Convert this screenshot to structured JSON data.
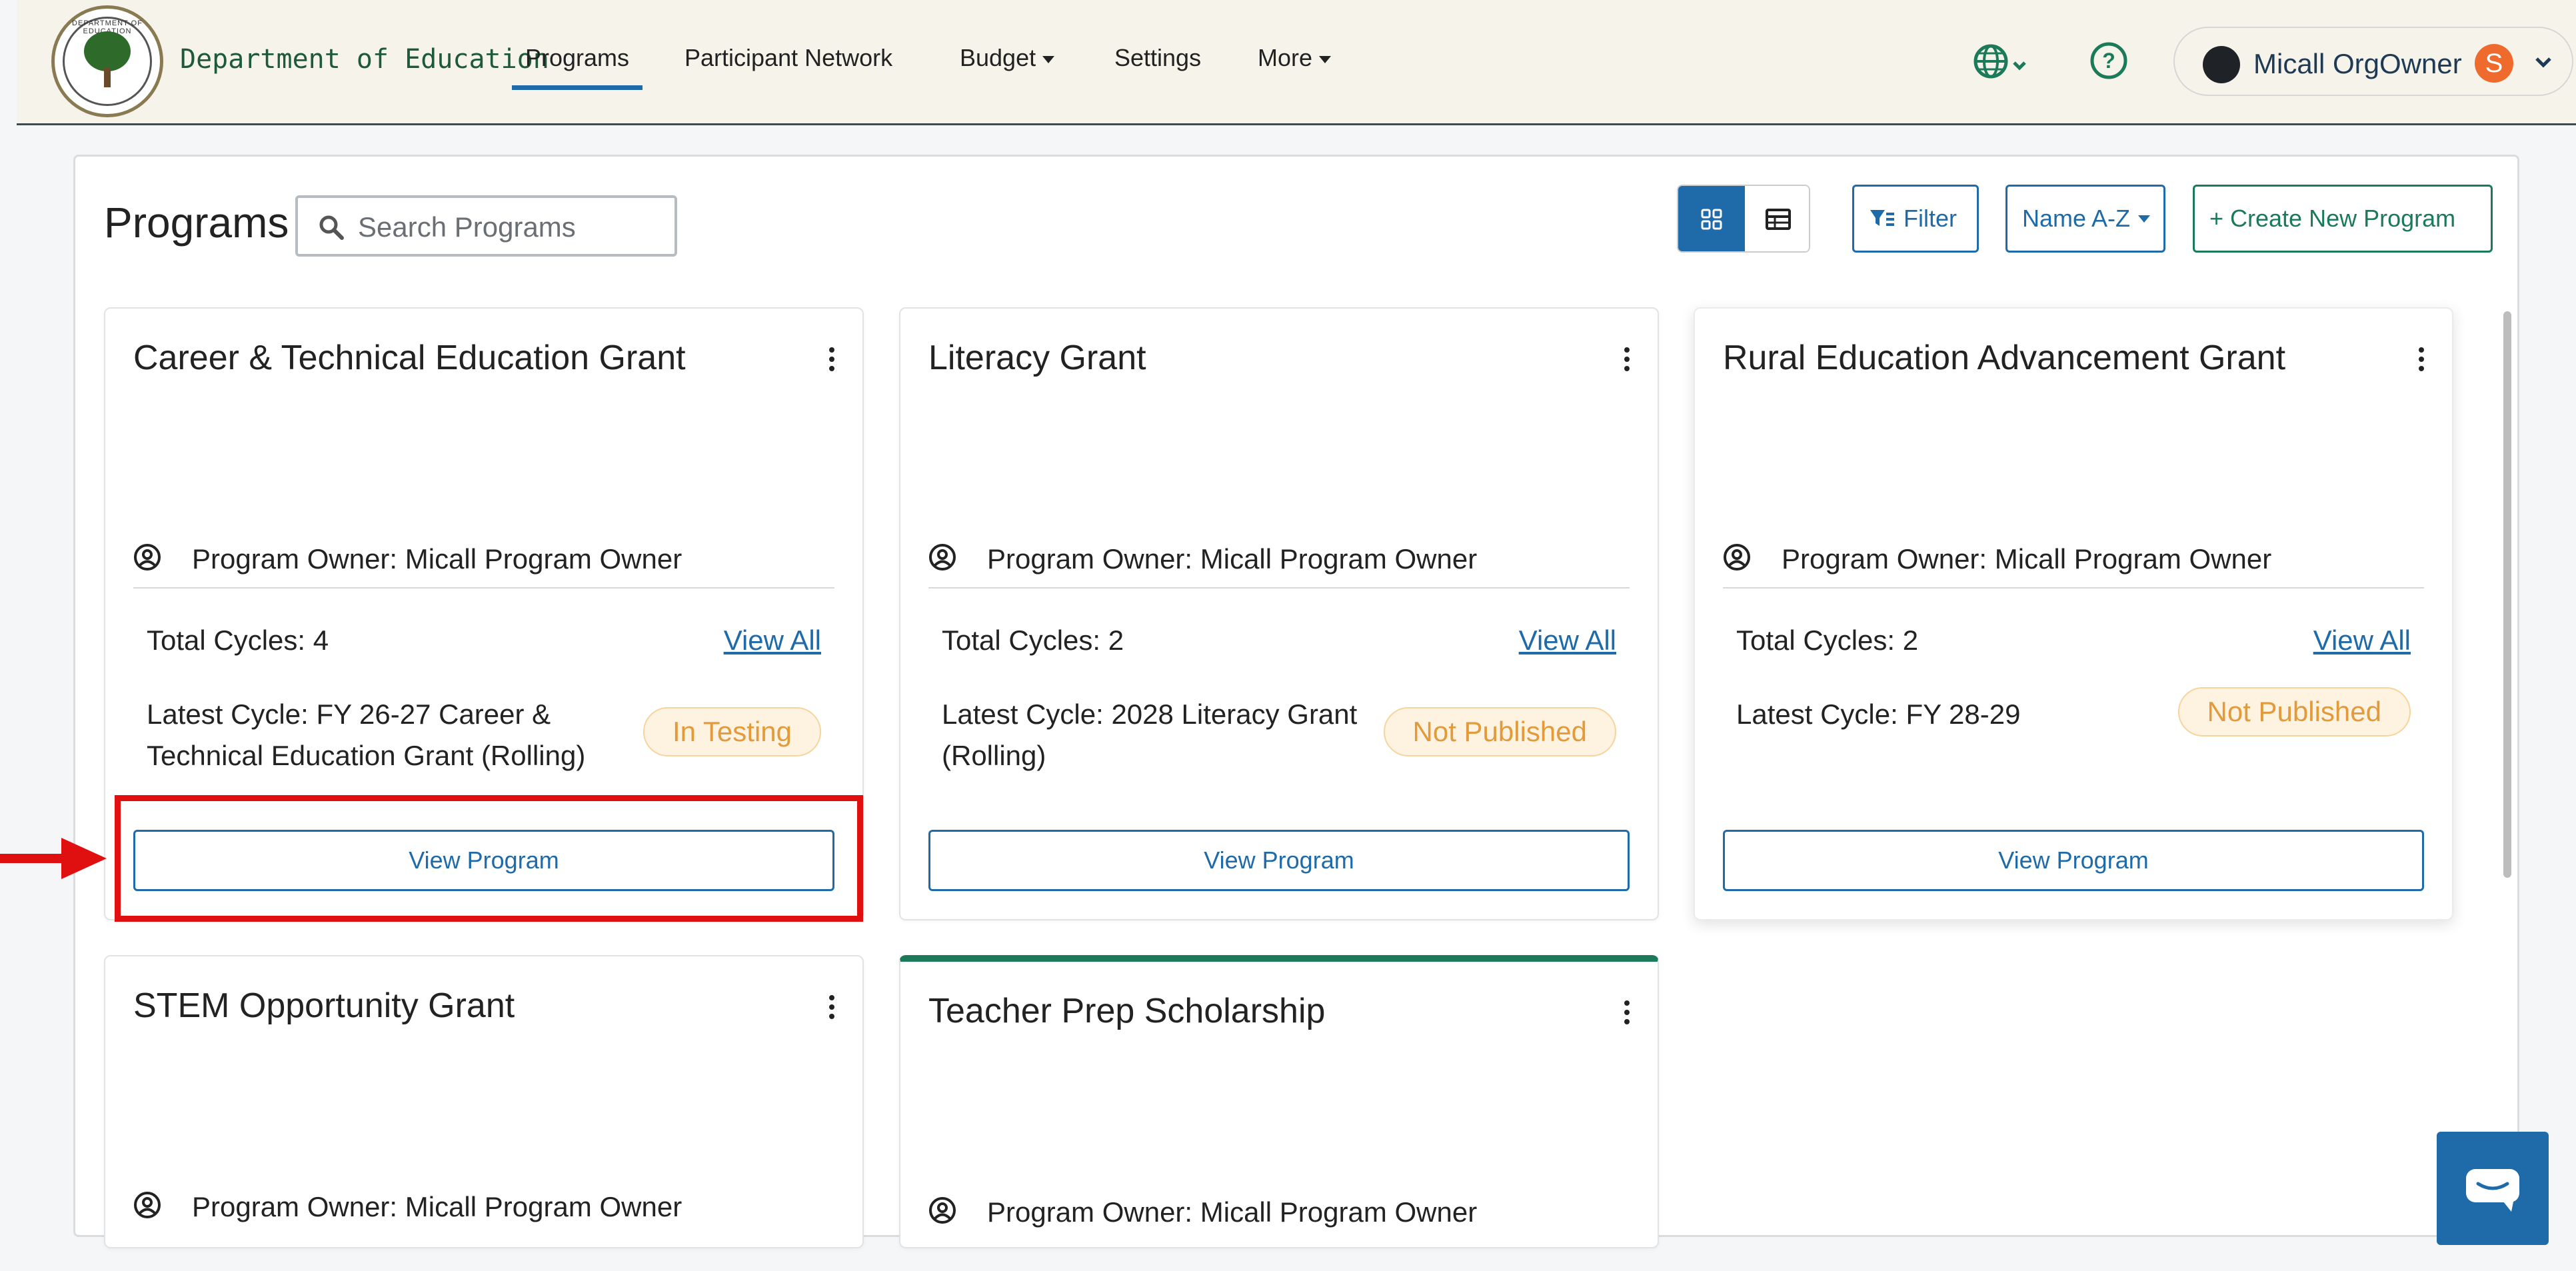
{
  "header": {
    "org_name": "Department of Education",
    "seal_text": "DEPARTMENT OF EDUCATION",
    "nav": [
      {
        "label": "Programs",
        "active": true
      },
      {
        "label": "Participant Network"
      },
      {
        "label": "Budget",
        "dropdown": true
      },
      {
        "label": "Settings"
      },
      {
        "label": "More",
        "dropdown": true
      }
    ],
    "user": {
      "name": "Micall OrgOwner",
      "badge_letter": "S"
    }
  },
  "page": {
    "title": "Programs",
    "search_placeholder": "Search Programs",
    "filter_label": "Filter",
    "sort_label": "Name A-Z",
    "create_label": "+ Create New Program"
  },
  "cards": [
    {
      "title": "Career & Technical Education Grant",
      "owner": "Program Owner: Micall Program Owner",
      "total_cycles": "Total Cycles: 4",
      "view_all": "View All",
      "latest_cycle": "Latest Cycle: FY 26-27 Career & Technical Education Grant (Rolling)",
      "status": "In Testing",
      "button": "View Program"
    },
    {
      "title": "Literacy Grant",
      "owner": "Program Owner: Micall Program Owner",
      "total_cycles": "Total Cycles: 2",
      "view_all": "View All",
      "latest_cycle": "Latest Cycle: 2028 Literacy Grant (Rolling)",
      "status": "Not Published",
      "button": "View Program"
    },
    {
      "title": "Rural Education Advancement Grant",
      "owner": "Program Owner: Micall Program Owner",
      "total_cycles": "Total Cycles: 2",
      "view_all": "View All",
      "latest_cycle": "Latest Cycle: FY 28-29",
      "status": "Not Published",
      "button": "View Program"
    },
    {
      "title": "STEM Opportunity Grant",
      "owner": "Program Owner: Micall Program Owner"
    },
    {
      "title": "Teacher Prep Scholarship",
      "owner": "Program Owner: Micall Program Owner"
    }
  ],
  "colors": {
    "brand_blue": "#1f6aa8",
    "brand_green": "#1b7a5a",
    "highlight_red": "#e01010",
    "status_orange": "#e29a3b"
  }
}
